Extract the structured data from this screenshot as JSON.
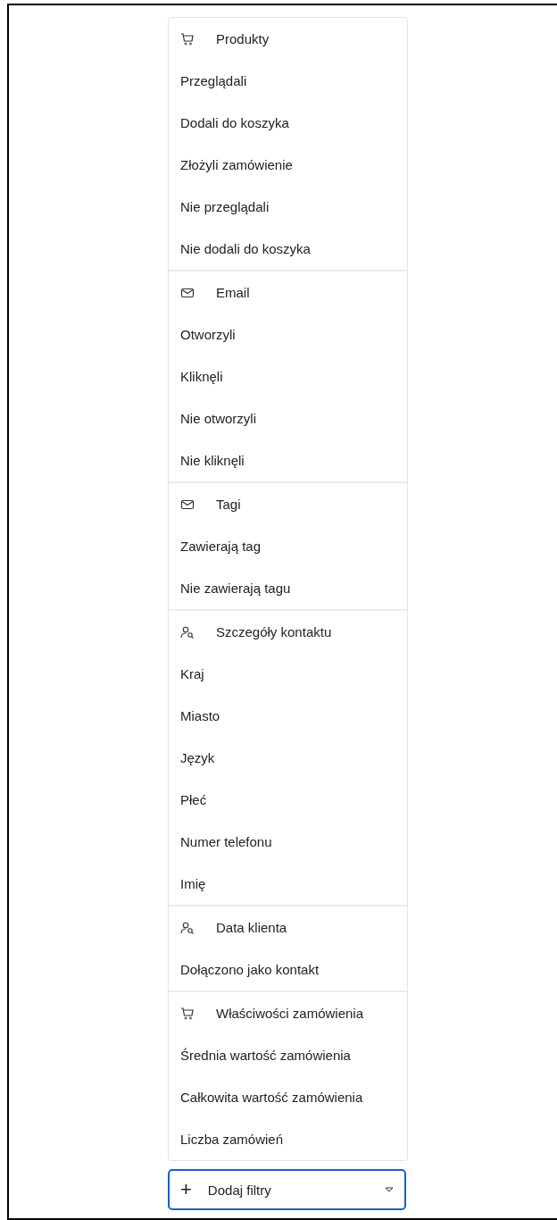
{
  "sections": [
    {
      "kind": "cart",
      "title": "Produkty",
      "items": [
        "Przeglądali",
        "Dodali do koszyka",
        "Złożyli zamówienie",
        "Nie przeglądali",
        "Nie dodali do koszyka"
      ]
    },
    {
      "kind": "mail",
      "title": "Email",
      "items": [
        "Otworzyli",
        "Kliknęli",
        "Nie otworzyli",
        "Nie kliknęli"
      ]
    },
    {
      "kind": "mail",
      "title": "Tagi",
      "items": [
        "Zawierają tag",
        "Nie zawierają tagu"
      ]
    },
    {
      "kind": "person",
      "title": "Szczegóły kontaktu",
      "items": [
        "Kraj",
        "Miasto",
        "Język",
        "Płeć",
        "Numer telefonu",
        "Imię"
      ]
    },
    {
      "kind": "person",
      "title": "Data klienta",
      "items": [
        "Dołączono jako kontakt"
      ]
    },
    {
      "kind": "cart",
      "title": "Właściwości zamówienia",
      "items": [
        "Średnia wartość zamówienia",
        "Całkowita wartość zamówienia",
        "Liczba zamówień"
      ]
    }
  ],
  "add_button": {
    "plus": "+",
    "label": "Dodaj filtry"
  }
}
